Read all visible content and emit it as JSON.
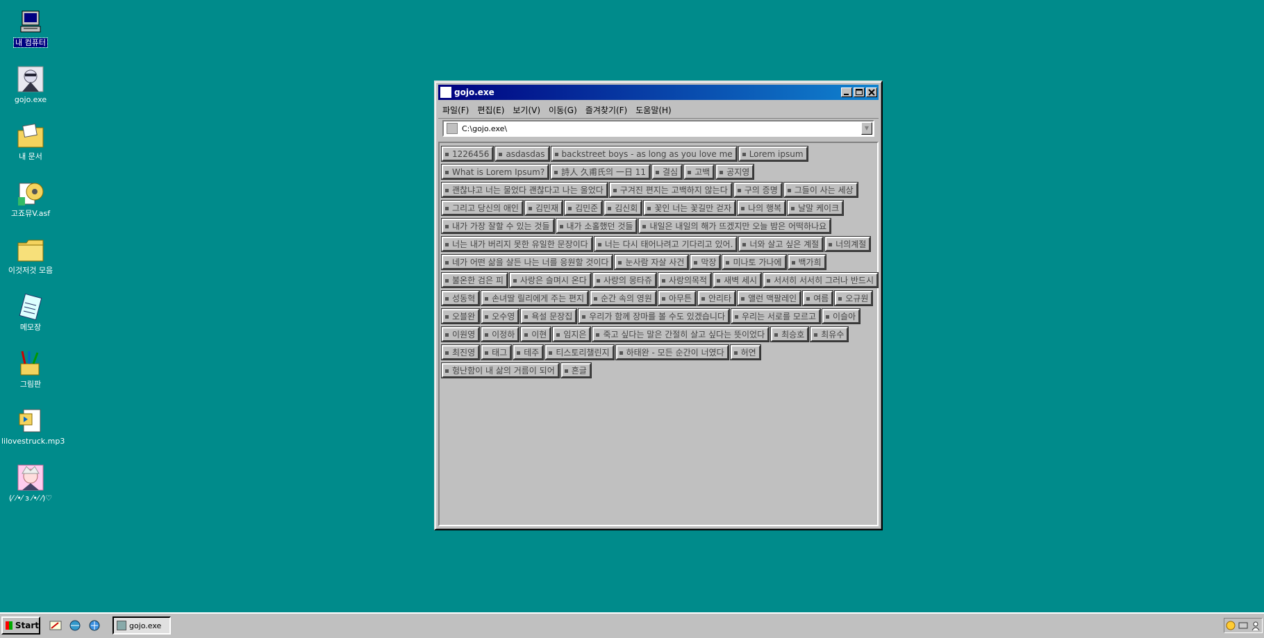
{
  "desktop": {
    "icons": [
      {
        "label": "내 컴퓨터",
        "icon": "computer-icon",
        "selected": true
      },
      {
        "label": "gojo.exe",
        "icon": "gojo-exe-icon",
        "selected": false
      },
      {
        "label": "내 문서",
        "icon": "my-documents-icon",
        "selected": false
      },
      {
        "label": "고죠뮤V.asf",
        "icon": "video-file-icon",
        "selected": false
      },
      {
        "label": "이것저것 모음",
        "icon": "folder-icon",
        "selected": false
      },
      {
        "label": "메모장",
        "icon": "notepad-icon",
        "selected": false
      },
      {
        "label": "그림판",
        "icon": "paint-icon",
        "selected": false
      },
      {
        "label": "lilovestruck.mp3",
        "icon": "audio-file-icon",
        "selected": false
      },
      {
        "label": "(⁄ ⁄•⁄ ɜ ⁄•⁄ ⁄)♡",
        "icon": "anime-avatar-icon",
        "selected": false
      }
    ]
  },
  "window": {
    "title": "gojo.exe",
    "menu": [
      "파일(F)",
      "편집(E)",
      "보기(V)",
      "이동(G)",
      "즐겨찾기(F)",
      "도움말(H)"
    ],
    "address": "C:\\gojo.exe\\",
    "tags": [
      "1226456",
      "asdasdas",
      "backstreet boys - as long as you love me",
      "Lorem ipsum",
      "What is Lorem Ipsum?",
      "詩人 久甫氏의 一日 11",
      "결심",
      "고백",
      "공지영",
      "괜찮냐고 너는 물었다 괜찮다고 나는 울었다",
      "구겨진 편지는 고백하지 않는다",
      "구의 증명",
      "그들이 사는 세상",
      "그리고 당신의 애인",
      "김민재",
      "김민준",
      "김신회",
      "꽃인 너는 꽃길만 걷자",
      "나의 행복",
      "날말 케이크",
      "내가 가장 잘할 수 있는 것들",
      "내가 소홀했던 것들",
      "내일은 내일의 해가 뜨겠지만 오늘 밤은 어떡하나요",
      "너는 내가 버리지 못한 유일한 문장이다",
      "너는 다시 태어나려고 기다리고 있어.",
      "너와 살고 싶은 계절",
      "너의계절",
      "네가 어떤 삶을 살든 나는 너를 응원할 것이다",
      "눈사람 자살 사건",
      "막장",
      "미나토 가나에",
      "백가희",
      "불온한 검은 피",
      "사랑은 슬며시 온다",
      "사랑의 몽타쥬",
      "사랑의목적",
      "새벽 세시",
      "서서히 서서히 그러나 반드시",
      "성동혁",
      "손녀딸 릴리에게 주는 편지",
      "순간 속의 영원",
      "아무튼",
      "안리타",
      "앨런 맥팔레인",
      "여름",
      "오규원",
      "오블완",
      "오수영",
      "욕설 문장집",
      "우리가 함께 장마를 볼 수도 있겠습니다",
      "우리는 서로를 모르고",
      "이슬아",
      "이원영",
      "이정하",
      "이현",
      "임지은",
      "죽고 싶다는 말은 간절히 살고 싶다는 뜻이었다",
      "최승호",
      "최유수",
      "최진영",
      "태그",
      "테주",
      "티스토리챌린지",
      "하태완 - 모든 순간이 너였다",
      "허연",
      "헝난함이 내 삶의 거름이 되어",
      "흔글"
    ]
  },
  "taskbar": {
    "start_label": "Start",
    "task_label": "gojo.exe",
    "quick_launch": [
      "desktop-quicklaunch-icon",
      "browser-quicklaunch-icon",
      "ie-quicklaunch-icon"
    ],
    "tray": [
      "messenger-tray-icon",
      "network-tray-icon",
      "user-tray-icon"
    ]
  }
}
